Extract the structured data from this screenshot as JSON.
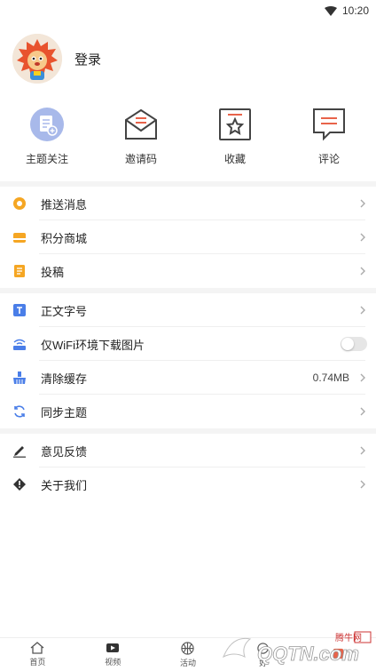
{
  "status_bar": {
    "time": "10:20"
  },
  "profile": {
    "login_label": "登录"
  },
  "quick_actions": [
    {
      "label": "主题关注",
      "icon": "doc-add-icon"
    },
    {
      "label": "邀请码",
      "icon": "envelope-icon"
    },
    {
      "label": "收藏",
      "icon": "bookmark-star-icon"
    },
    {
      "label": "评论",
      "icon": "comment-icon"
    }
  ],
  "menu_group1": [
    {
      "label": "推送消息",
      "icon": "push-icon"
    },
    {
      "label": "积分商城",
      "icon": "mall-icon"
    },
    {
      "label": "投稿",
      "icon": "submit-icon"
    }
  ],
  "menu_group2": [
    {
      "label": "正文字号",
      "icon": "font-size-icon"
    },
    {
      "label": "仅WiFi环境下载图片",
      "icon": "wifi-image-icon",
      "toggle": false
    },
    {
      "label": "清除缓存",
      "icon": "broom-icon",
      "value": "0.74MB"
    },
    {
      "label": "同步主题",
      "icon": "sync-icon"
    }
  ],
  "menu_group3": [
    {
      "label": "意见反馈",
      "icon": "pen-icon"
    },
    {
      "label": "关于我们",
      "icon": "info-diamond-icon"
    }
  ],
  "tabbar": [
    {
      "label": "首页",
      "icon": "home-icon"
    },
    {
      "label": "视频",
      "icon": "video-icon"
    },
    {
      "label": "活动",
      "icon": "basketball-icon"
    },
    {
      "label": "好",
      "icon": "tab4-icon"
    },
    {
      "label": "",
      "icon": "tab5-icon"
    }
  ],
  "watermark": {
    "text": "QQTN.com",
    "subtext": "腾牛网"
  },
  "colors": {
    "accent": "#e8634a",
    "blue": "#4a7ee8",
    "orange": "#f5a623"
  }
}
